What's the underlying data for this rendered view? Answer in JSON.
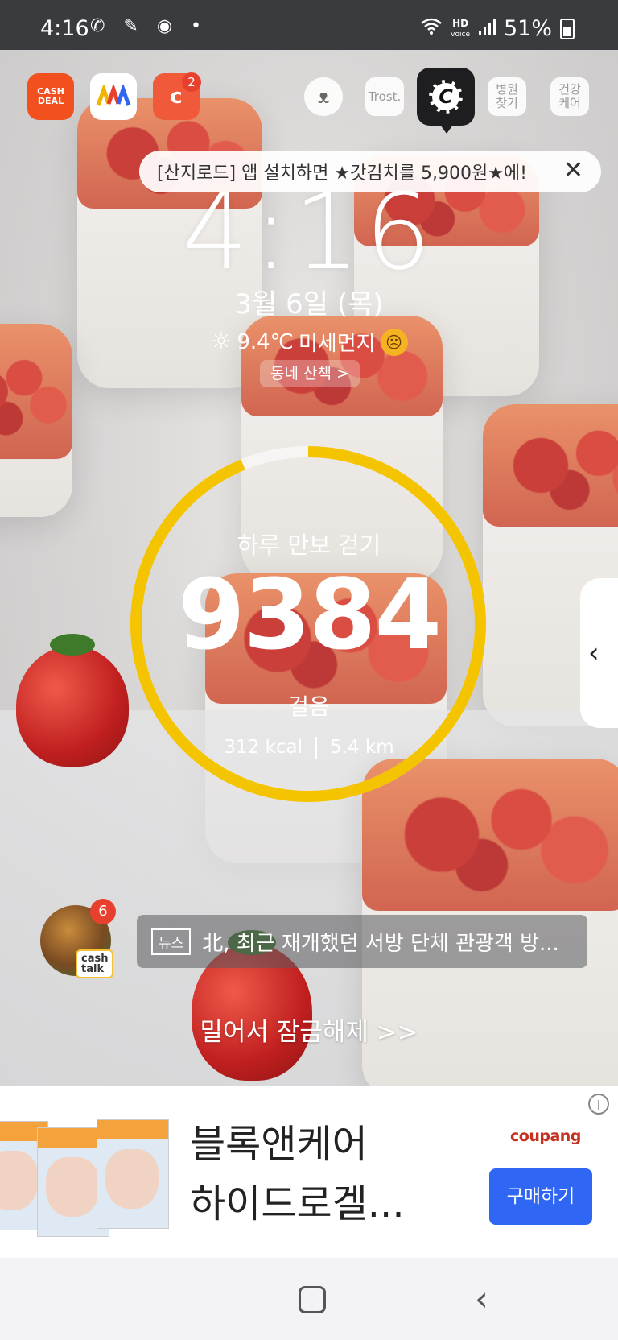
{
  "status_bar": {
    "time": "4:16",
    "left_icons": "✆ ✎ ◉ •",
    "hd_label": "HD",
    "voice_label": "voice",
    "battery": "51%"
  },
  "shortcuts": {
    "cash_deal_label": "CASH DEAL",
    "c_app_badge": "2",
    "trost_label": "Trost.",
    "hospital_label": "병원 찾기",
    "health_label": "건강 케어",
    "active_letter": "C"
  },
  "promo": {
    "text": "[산지로드] 앱 설치하면 ★갓김치를 5,900원★에!",
    "close": "✕"
  },
  "lockscreen": {
    "clock": "4:16",
    "date": "3월 6일 (목)",
    "temperature": "9.4℃",
    "dust_label": "미세먼지",
    "walk_button": "동네 산책 >"
  },
  "steps": {
    "title": "하루 만보 걷기",
    "count": "9384",
    "unit": "걸음",
    "kcal": "312 kcal",
    "distance": "5.4 km",
    "progress": 0.938
  },
  "cashtalk": {
    "badge": "6",
    "label": "cash talk"
  },
  "news": {
    "tag": "뉴스",
    "headline": "北, 최근 재개했던 서방 단체 관광객 방..."
  },
  "unlock_text": "밀어서 잠금해제 >>",
  "ad": {
    "title_line1": "블록앤케어",
    "title_line2": "하이드로겔...",
    "brand": "coupang",
    "info": "i",
    "cta": "구매하기"
  },
  "colors": {
    "ring": "#f5c400",
    "ring_track": "rgba(255,255,255,0.55)",
    "cta": "#2f66f3",
    "badge": "#e8402f"
  }
}
